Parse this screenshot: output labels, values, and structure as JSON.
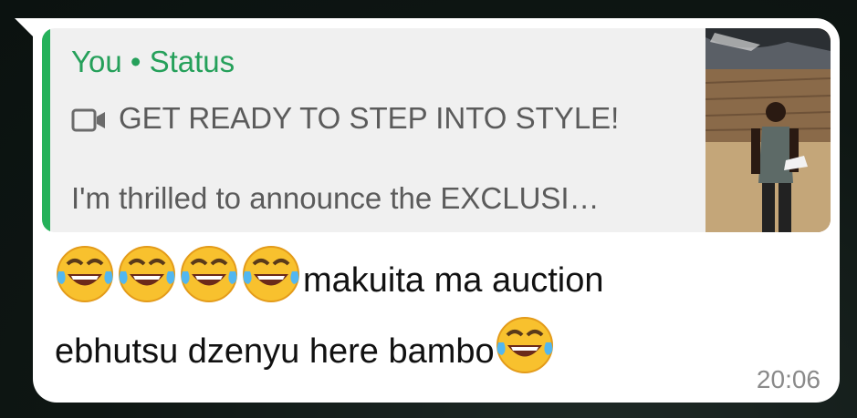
{
  "reply": {
    "author": "You",
    "separator": "•",
    "context": "Status",
    "line1": "GET READY TO STEP INTO STYLE!",
    "line2": "I'm thrilled to announce the EXCLUSI…",
    "media_icon": "video-icon",
    "thumbnail": "status-thumbnail-person-holding-sneaker"
  },
  "message": {
    "text_part1": "makuita ma auction",
    "text_part2": "ebhutsu dzenyu here bambo",
    "emoji": "face-with-tears-of-joy",
    "time": "20:06"
  },
  "colors": {
    "accent": "#25b15a",
    "bubble": "#ffffff",
    "quote_bg": "#f0f0f0"
  }
}
